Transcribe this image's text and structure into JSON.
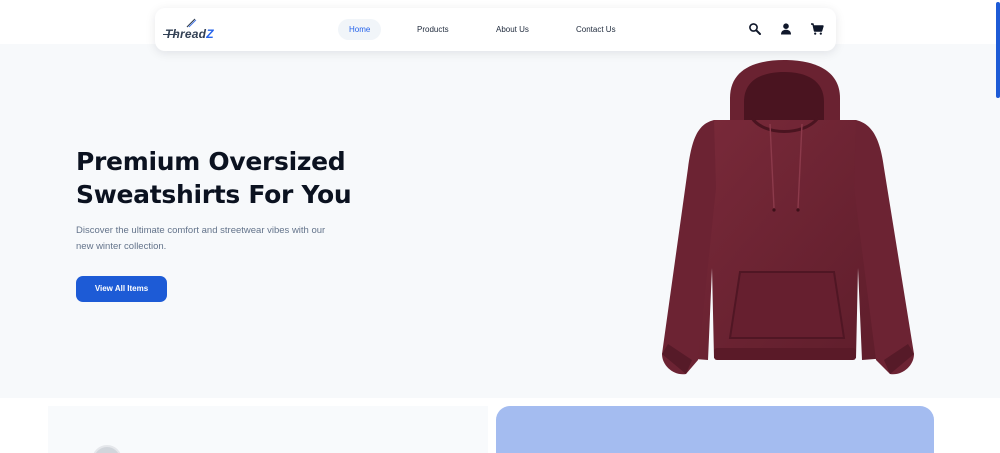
{
  "brand": {
    "name_main": "Thread",
    "name_accent": "Z"
  },
  "nav": {
    "links": [
      {
        "label": "Home",
        "active": true
      },
      {
        "label": "Products",
        "active": false
      },
      {
        "label": "About Us",
        "active": false
      },
      {
        "label": "Contact Us",
        "active": false
      }
    ],
    "icons": [
      "search-icon",
      "user-icon",
      "cart-icon"
    ]
  },
  "hero": {
    "title_line1": "Premium Oversized",
    "title_line2": "Sweatshirts For You",
    "subtitle": "Discover the ultimate comfort and streetwear vibes with our new winter collection.",
    "cta_label": "View All Items",
    "product_image": "maroon-oversized-hoodie"
  },
  "colors": {
    "accent": "#1d5bd6",
    "hoodie": "#6e2433",
    "feature_panel": "#a4bcf0",
    "heading": "#0b1220",
    "body_text": "#64748b"
  }
}
